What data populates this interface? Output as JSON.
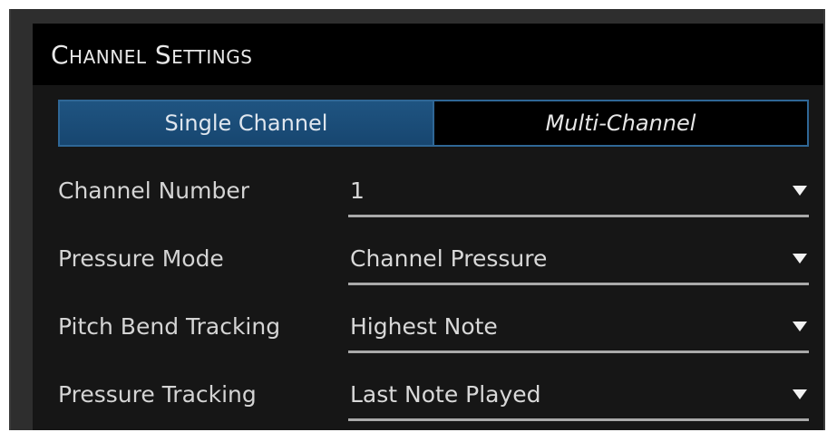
{
  "header": {
    "title": "Channel Settings"
  },
  "mode_toggle": {
    "options": [
      {
        "label": "Single Channel",
        "selected": true
      },
      {
        "label": "Multi-Channel",
        "selected": false
      }
    ]
  },
  "settings": [
    {
      "label": "Channel Number",
      "value": "1"
    },
    {
      "label": "Pressure Mode",
      "value": "Channel Pressure"
    },
    {
      "label": "Pitch Bend Tracking",
      "value": "Highest Note"
    },
    {
      "label": "Pressure Tracking",
      "value": "Last Note Played"
    }
  ],
  "icons": {
    "dropdown": "chevron-down-icon"
  },
  "colors": {
    "accent": "#1f5481",
    "accent_border": "#2f6796",
    "header_bg": "#000000",
    "panel_bg": "#161616"
  }
}
